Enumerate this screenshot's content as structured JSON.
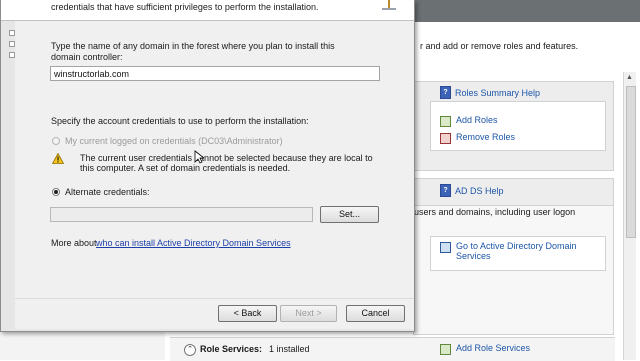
{
  "server_manager": {
    "roles_description": "r and add or remove roles and features.",
    "ad_ds_description": "users and domains, including user logon",
    "roles_summary_help": "Roles Summary Help",
    "add_roles": "Add Roles",
    "remove_roles": "Remove Roles",
    "ad_ds_help": "AD DS Help",
    "goto_adds": "Go to Active Directory Domain Services",
    "role_services_label": "Role Services:",
    "role_services_value": "1 installed",
    "add_role_services": "Add Role Services"
  },
  "dialog": {
    "banner_text": "credentials that have sufficient privileges to perform the installation.",
    "domain_prompt": "Type the name of any domain in the forest where you plan to install this domain controller:",
    "domain_value": "winstructorlab.com",
    "credentials_heading": "Specify the account credentials to use to perform the installation:",
    "current_credentials_label": "My current logged on credentials (DC03\\Administrator)",
    "warning_text": "The current user credentials cannot be selected because they are local to this computer. A set of domain credentials is needed.",
    "alternate_credentials_label": "Alternate credentials:",
    "alternate_credentials_value": "",
    "set_button": "Set...",
    "more_about_prefix": "More about",
    "more_about_link": "who can install Active Directory Domain Services",
    "back_button": "< Back",
    "next_button": "Next >",
    "cancel_button": "Cancel"
  },
  "colors": {
    "link": "#1d3fa8",
    "header_bar": "#6b7072",
    "dialog_body": "#f0f0f0"
  },
  "icons": [
    "warning-icon",
    "help-icon",
    "add-roles-icon",
    "remove-roles-icon",
    "adds-icon",
    "add-role-services-icon",
    "mouse-cursor-icon"
  ]
}
